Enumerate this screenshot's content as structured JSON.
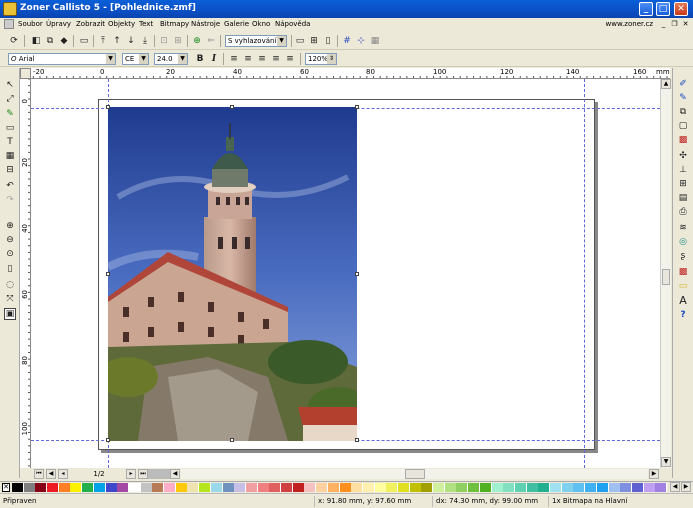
{
  "window": {
    "title": "Zoner Callisto 5 - [Pohlednice.zmf]",
    "minimize": "_",
    "maximize": "□",
    "close": "✕"
  },
  "menu": {
    "items": [
      "Soubor",
      "Úpravy",
      "Zobrazit",
      "Objekty",
      "Text",
      "Bitmapy",
      "Nástroje",
      "Galerie",
      "Okno",
      "Nápověda"
    ],
    "url": "www.zoner.cz"
  },
  "toolbar1": {
    "smoothing_value": "S vyhlazováním"
  },
  "toolbar2": {
    "font_value": "Arial",
    "charset_value": "CE",
    "size_value": "24.0",
    "bold_label": "B",
    "italic_label": "I",
    "zoom_value": "120%"
  },
  "ruler": {
    "h_ticks": [
      "-20",
      "0",
      "20",
      "40",
      "60",
      "80",
      "100",
      "120",
      "140",
      "160"
    ],
    "h_unit": "mm",
    "v_ticks": [
      "0",
      "20",
      "40",
      "60",
      "80",
      "100"
    ]
  },
  "navigator": {
    "page_indicator": "1/2"
  },
  "palette": {
    "colors": [
      "#000000",
      "#7f7f7f",
      "#880015",
      "#ed1c24",
      "#ff7f27",
      "#fff200",
      "#22b14c",
      "#00a2e8",
      "#3f48cc",
      "#a349a4",
      "#ffffff",
      "#c3c3c3",
      "#b97a57",
      "#ffaec9",
      "#ffc90e",
      "#efe4b0",
      "#b5e61d",
      "#99d9ea",
      "#7092be",
      "#c8bfe7",
      "#f0a0a0",
      "#f08080",
      "#e06060",
      "#d04040",
      "#c02020",
      "#f5c0c0",
      "#ffd0a0",
      "#ffb060",
      "#ff9020",
      "#ffe0a0",
      "#fff0b0",
      "#ffffa0",
      "#f0f060",
      "#e0e020",
      "#c0c000",
      "#a0a000",
      "#d0f0a0",
      "#b0e080",
      "#90d060",
      "#70c040",
      "#50b020",
      "#a0f0d0",
      "#80e0c0",
      "#60d0b0",
      "#40c0a0",
      "#20b090",
      "#a0e0f0",
      "#80d0f0",
      "#60c0f0",
      "#40b0f0",
      "#20a0f0",
      "#a0c0f0",
      "#8090e0",
      "#6060d0",
      "#c0a0f0",
      "#a080e0"
    ]
  },
  "status": {
    "state": "Připraven",
    "position": "x: 91.80 mm, y: 97.60 mm",
    "delta": "dx: 74.30 mm, dy: 99.00 mm",
    "selection": "1x Bitmapa na Hlavní"
  }
}
